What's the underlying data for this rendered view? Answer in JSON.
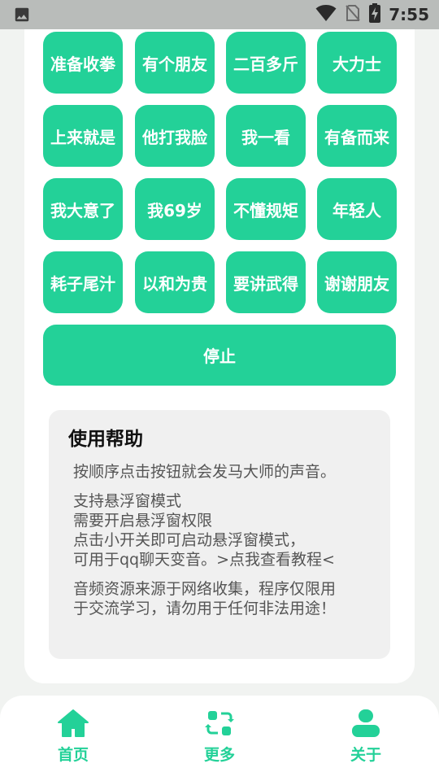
{
  "status_bar": {
    "time": "7:55",
    "icons": [
      "image-icon",
      "wifi-icon",
      "no-sim-icon",
      "battery-charging-icon"
    ]
  },
  "sound_buttons": [
    {
      "label": ""
    },
    {
      "label": ""
    },
    {
      "label": ""
    },
    {
      "label": ""
    },
    {
      "label": "准备收拳"
    },
    {
      "label": "有个朋友"
    },
    {
      "label": "二百多斤"
    },
    {
      "label": "大力士"
    },
    {
      "label": "上来就是"
    },
    {
      "label": "他打我脸"
    },
    {
      "label": "我一看"
    },
    {
      "label": "有备而来"
    },
    {
      "label": "我大意了"
    },
    {
      "label": "我69岁"
    },
    {
      "label": "不懂规矩"
    },
    {
      "label": "年轻人"
    },
    {
      "label": "耗子尾汁"
    },
    {
      "label": "以和为贵"
    },
    {
      "label": "要讲武得"
    },
    {
      "label": "谢谢朋友"
    }
  ],
  "stop_button": {
    "label": "停止"
  },
  "help": {
    "title": "使用帮助",
    "para1": [
      "按顺序点击按钮就会发马大师的声音。"
    ],
    "para2": [
      "支持悬浮窗模式",
      "需要开启悬浮窗权限",
      "点击小开关即可启动悬浮窗模式，",
      "可用于qq聊天变音。>点我查看教程<"
    ],
    "para3": [
      "音频资源来源于网络收集，程序仅限用",
      "于交流学习，请勿用于任何非法用途！"
    ]
  },
  "nav": {
    "items": [
      {
        "label": "首页",
        "icon": "home-icon"
      },
      {
        "label": "更多",
        "icon": "refresh-icon"
      },
      {
        "label": "关于",
        "icon": "person-icon"
      }
    ],
    "accent": "#23d198"
  },
  "colors": {
    "accent": "#23d198",
    "status_bar": "#b9bcba",
    "page_bg": "#f1f3f1",
    "card_bg": "#ffffff",
    "help_bg": "#f0f0f0"
  }
}
